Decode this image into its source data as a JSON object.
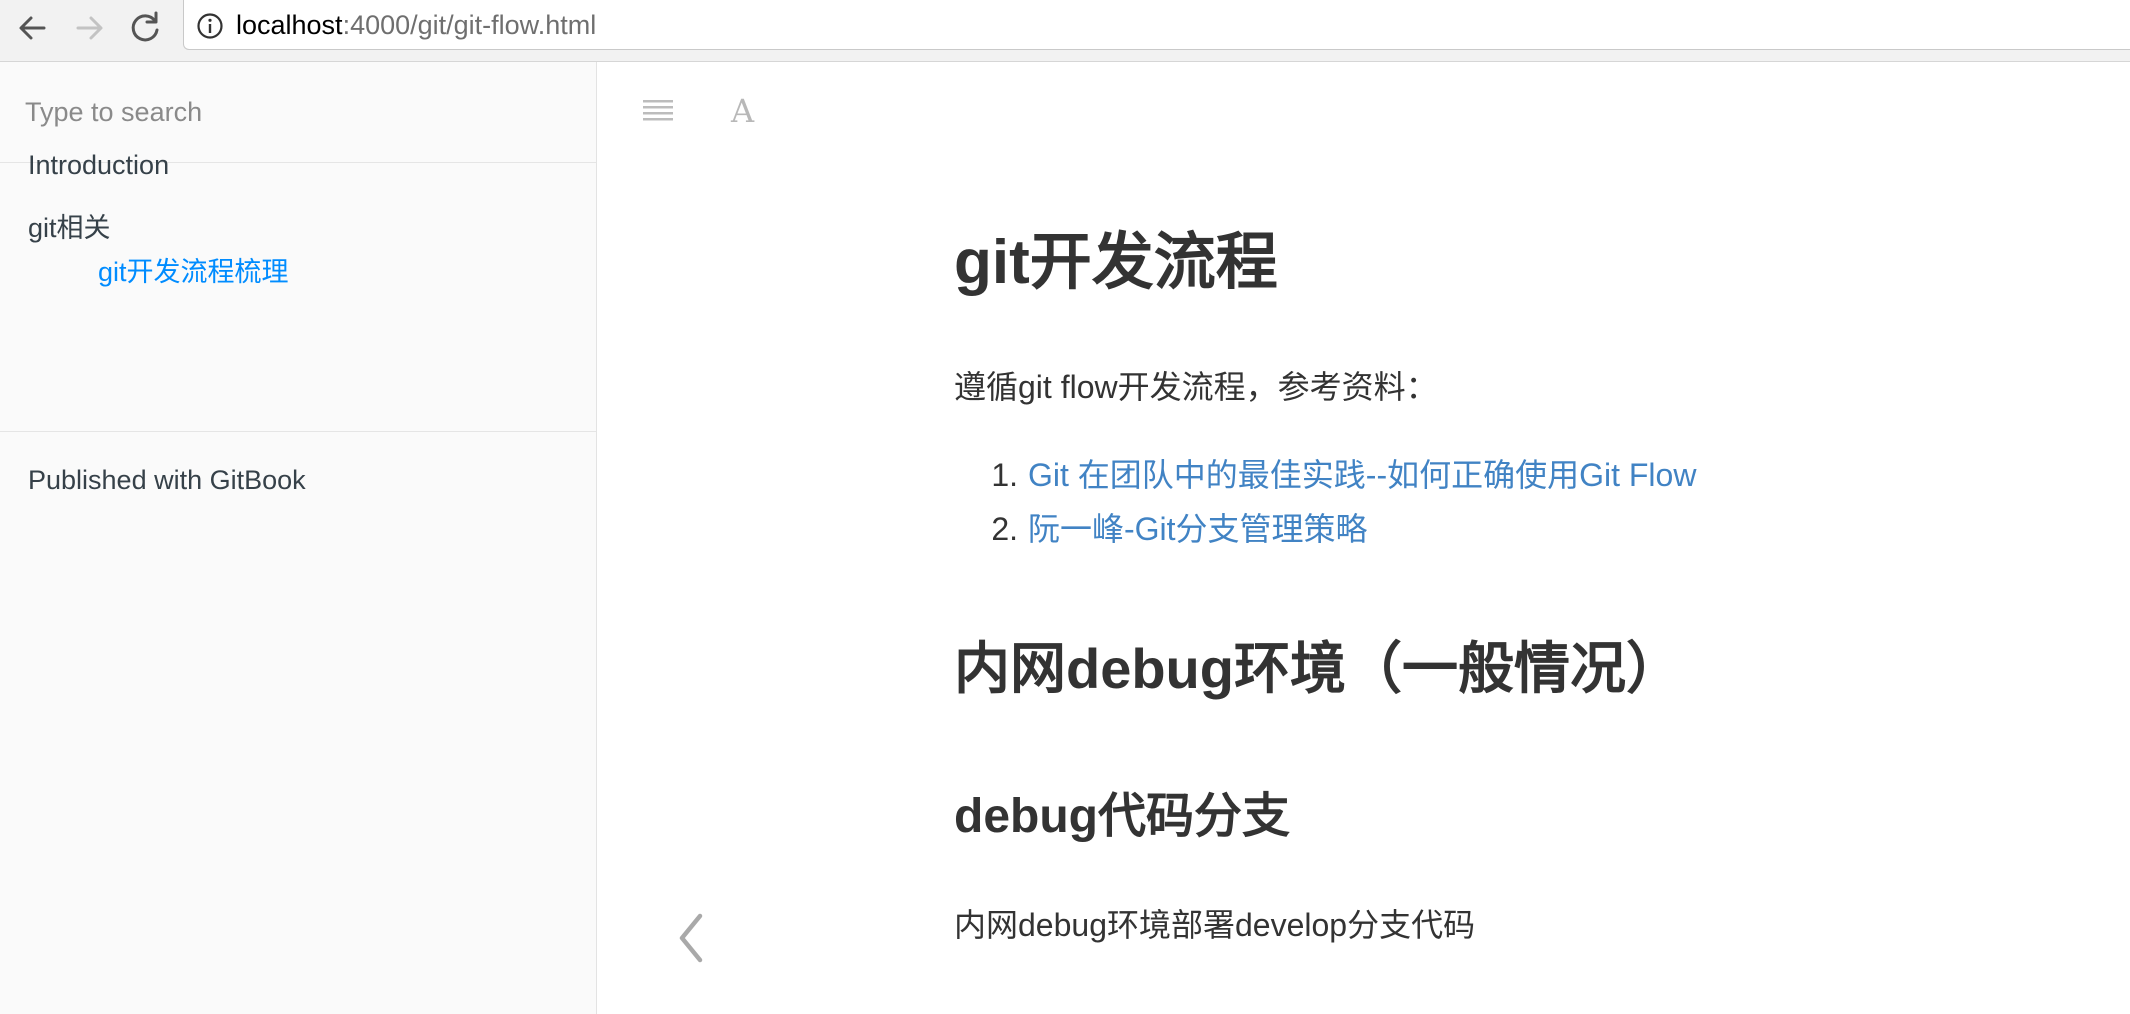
{
  "browser": {
    "url_host": "localhost",
    "url_path": ":4000/git/git-flow.html",
    "back_icon": "arrow-left-icon",
    "forward_icon": "arrow-right-icon",
    "reload_icon": "reload-icon",
    "site_info_icon": "info-circle-icon"
  },
  "sidebar": {
    "search_placeholder": "Type to search",
    "items": [
      {
        "label": "Introduction"
      },
      {
        "label": "git相关"
      }
    ],
    "sub_items": [
      {
        "label": "git开发流程梳理",
        "active": true
      }
    ],
    "footer_label": "Published with GitBook"
  },
  "toolbar": {
    "toggle_icon": "hamburger-menu-icon",
    "font_icon": "font-settings-icon",
    "font_glyph": "A"
  },
  "content": {
    "title": "git开发流程",
    "intro": "遵循git flow开发流程，参考资料：",
    "refs": [
      {
        "num": "1.",
        "text": "Git 在团队中的最佳实践--如何正确使用Git Flow"
      },
      {
        "num": "2.",
        "text": "阮一峰-Git分支管理策略"
      }
    ],
    "section_title": "内网debug环境（一般情况）",
    "subsection_title": "debug代码分支",
    "paragraph": "内网debug环境部署develop分支代码"
  },
  "navigation": {
    "prev_icon": "chevron-left-icon"
  },
  "colors": {
    "link": "#4183c4",
    "active_nav": "#008cff",
    "sidebar_bg": "#fafafa",
    "text": "#333333"
  }
}
